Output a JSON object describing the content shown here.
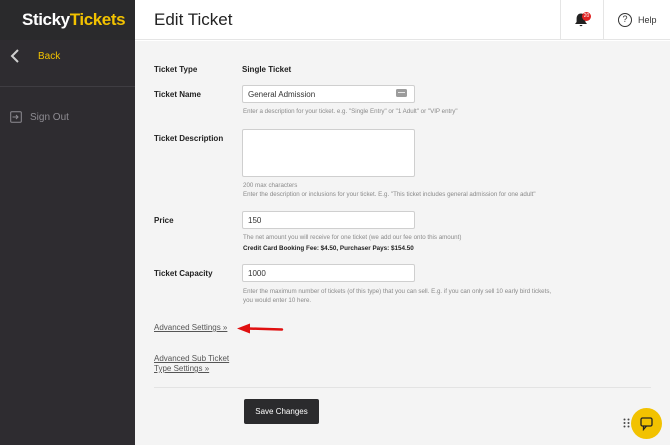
{
  "brand": {
    "part1": "Sticky",
    "part2": "Tickets",
    "accent": "#f2c200"
  },
  "sidebar": {
    "back_label": "Back",
    "signout_label": "Sign Out"
  },
  "header": {
    "title": "Edit Ticket",
    "notification_count": "20",
    "help_label": "Help"
  },
  "form": {
    "ticket_type": {
      "label": "Ticket Type",
      "value": "Single Ticket"
    },
    "ticket_name": {
      "label": "Ticket Name",
      "value": "General Admission",
      "help": "Enter a description for your ticket. e.g. \"Single Entry\" or \"1 Adult\" or \"VIP entry\""
    },
    "ticket_description": {
      "label": "Ticket Description",
      "value": "",
      "max_chars": "200 max characters",
      "help": "Enter the description or inclusions for your ticket. E.g. \"This ticket includes general admission for one adult\""
    },
    "price": {
      "label": "Price",
      "value": "150",
      "help": "The net amount you will receive for one ticket (we add our fee onto this amount)",
      "fee_note": "Credit Card Booking Fee: $4.50, Purchaser Pays: $154.50"
    },
    "capacity": {
      "label": "Ticket Capacity",
      "value": "1000",
      "help_line1": "Enter the maximum number of tickets (of this type) that you can sell. E.g. if you can only sell 10 early bird tickets,",
      "help_line2": "you would enter 10 here."
    },
    "advanced_settings_link": "Advanced Settings »",
    "advanced_sub_line1": "Advanced Sub Ticket",
    "advanced_sub_line2": "Type Settings »",
    "save_label": "Save Changes"
  },
  "icons": {
    "back": "chevron-left-icon",
    "signout": "sign-out-icon",
    "bell": "bell-icon",
    "help": "question-circle-icon",
    "annotation": "red-arrow-icon",
    "chat": "chat-icon"
  },
  "colors": {
    "sidebar": "#2e2c30",
    "annotation_arrow": "#e01010",
    "notification_badge": "#e02424"
  }
}
